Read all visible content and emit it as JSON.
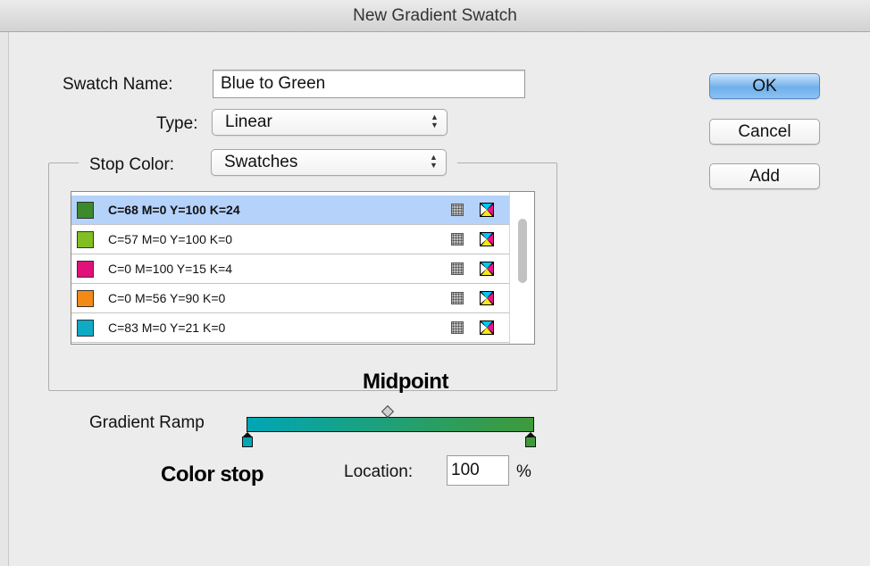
{
  "window": {
    "title": "New Gradient Swatch"
  },
  "form": {
    "swatch_name_label": "Swatch Name:",
    "swatch_name_value": "Blue to Green",
    "type_label": "Type:",
    "type_value": "Linear",
    "stop_color_label": "Stop Color:",
    "stop_color_value": "Swatches"
  },
  "buttons": {
    "ok": "OK",
    "cancel": "Cancel",
    "add": "Add"
  },
  "swatches": [
    {
      "name": "C=68 M=0 Y=100 K=24",
      "color": "#3b8a2b",
      "selected": true
    },
    {
      "name": "C=57 M=0 Y=100 K=0",
      "color": "#7fbf22",
      "selected": false
    },
    {
      "name": "C=0 M=100 Y=15 K=4",
      "color": "#e0117a",
      "selected": false
    },
    {
      "name": "C=0 M=56 Y=90 K=0",
      "color": "#f48a16",
      "selected": false
    },
    {
      "name": "C=83 M=0 Y=21 K=0",
      "color": "#10aac4",
      "selected": false
    }
  ],
  "gradient": {
    "ramp_label": "Gradient Ramp",
    "start_color": "#00a6b4",
    "end_color": "#3f9a3a",
    "location_label": "Location:",
    "location_value": "100",
    "percent_sign": "%"
  },
  "annotations": {
    "midpoint": "Midpoint",
    "color_stop": "Color stop"
  }
}
